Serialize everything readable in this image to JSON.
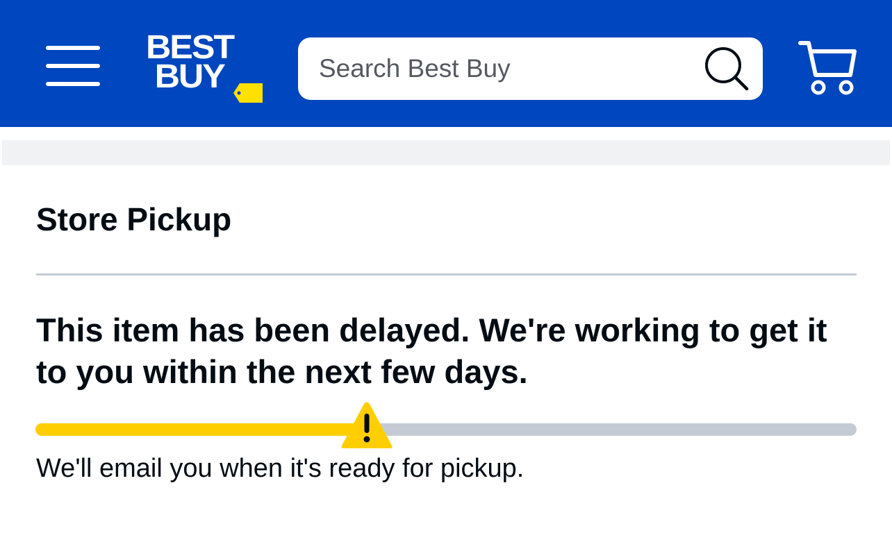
{
  "header": {
    "brand": {
      "line1": "BEST",
      "line2": "BUY"
    },
    "search": {
      "placeholder": "Search Best Buy",
      "value": ""
    },
    "icons": [
      "menu-icon",
      "search-icon",
      "cart-icon"
    ],
    "brand_color": "#0046be",
    "accent_color": "#ffe000"
  },
  "main": {
    "section_title": "Store Pickup",
    "status_message": "This item has been delayed. We're working to get it to you within the next few days.",
    "progress": {
      "percent": 40,
      "status_icon": "warning-icon",
      "fill_color": "#ffce00",
      "track_color": "#c5cbd5"
    },
    "note": "We'll email you when it's ready for pickup."
  }
}
